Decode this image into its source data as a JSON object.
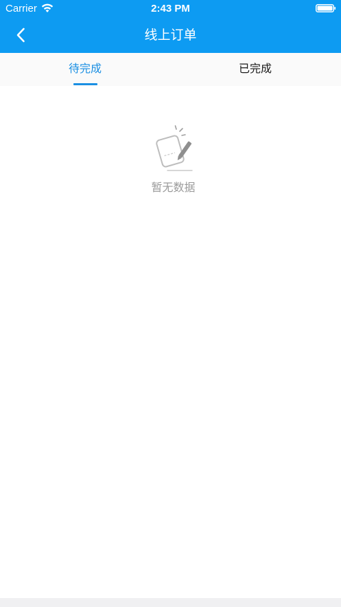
{
  "status_bar": {
    "carrier": "Carrier",
    "time": "2:43 PM"
  },
  "nav": {
    "title": "线上订单",
    "back_icon": "chevron-left-icon"
  },
  "tabs": [
    {
      "label": "待完成",
      "selected": true
    },
    {
      "label": "已完成",
      "selected": false
    }
  ],
  "empty_state": {
    "icon": "empty-document-icon",
    "message": "暂无数据"
  },
  "colors": {
    "header_bg": "#0d9bf2",
    "tab_active": "#1a8fe3",
    "tab_inactive": "#1a1a1a",
    "empty_text": "#9a9a9a"
  }
}
